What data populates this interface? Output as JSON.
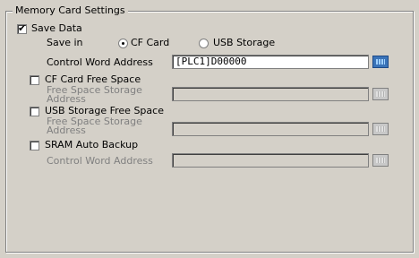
{
  "group_title": "Memory Card Settings",
  "save_data": {
    "label": "Save Data",
    "checked": true
  },
  "save_in": {
    "label": "Save in",
    "options": [
      {
        "label": "CF Card",
        "selected": true
      },
      {
        "label": "USB Storage",
        "selected": false
      }
    ]
  },
  "control_word": {
    "label": "Control Word Address",
    "value": "[PLC1]D00000"
  },
  "cf_free_space": {
    "label": "CF Card Free Space",
    "checked": false,
    "address_label_line1": "Free Space Storage",
    "address_label_line2": "Address",
    "value": ""
  },
  "usb_free_space": {
    "label": "USB Storage Free Space",
    "checked": false,
    "address_label_line1": "Free Space Storage",
    "address_label_line2": "Address",
    "value": ""
  },
  "sram_backup": {
    "label": "SRAM Auto Backup",
    "checked": false,
    "address_label": "Control Word Address",
    "value": ""
  },
  "icons": {
    "checkmark": "✔",
    "address_button_icon": "keypad-icon"
  }
}
